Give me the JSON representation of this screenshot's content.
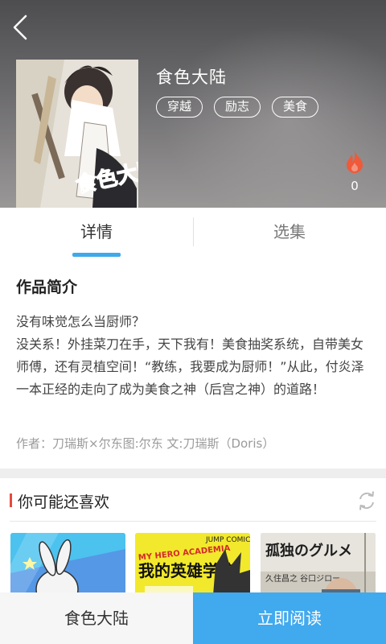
{
  "header": {
    "title": "食色大陆",
    "tags": [
      "穿越",
      "励志",
      "美食"
    ],
    "hot_count": "0",
    "cover_text": "食色大陆"
  },
  "tabs": [
    {
      "label": "详情"
    },
    {
      "label": "选集"
    }
  ],
  "intro": {
    "title": "作品简介",
    "lines": [
      "没有味觉怎么当厨师？",
      "没关系！外挂菜刀在手，天下我有！美食抽奖系统，自带美女师傅，还有灵植空间！“教练，我要成为厨师！”从此，付炎泽一本正经的走向了成为美食之神（后宫之神）的道路！"
    ],
    "author": "作者：刀瑞斯×尔东图:尔东 文:刀瑞斯（Doris）"
  },
  "recommend": {
    "title": "你可能还喜欢",
    "items": [
      {
        "text": ""
      },
      {
        "text": "我的英雄学院",
        "top": "MY HERO ACADEMIA",
        "corner": "JUMP COMICS"
      },
      {
        "text": "孤独のグルメ",
        "sub": "久住昌之 谷口ジロー"
      }
    ]
  },
  "bottom": {
    "name": "食色大陆",
    "read_label": "立即阅读"
  },
  "colors": {
    "accent": "#41a9ee",
    "tab_indicator": "#3fa9ea",
    "section_marker": "#e44b3c",
    "fire": "#ee5a3a"
  },
  "icons": {
    "back": "chevron-left-icon",
    "hot": "flame-icon",
    "refresh": "refresh-icon"
  }
}
